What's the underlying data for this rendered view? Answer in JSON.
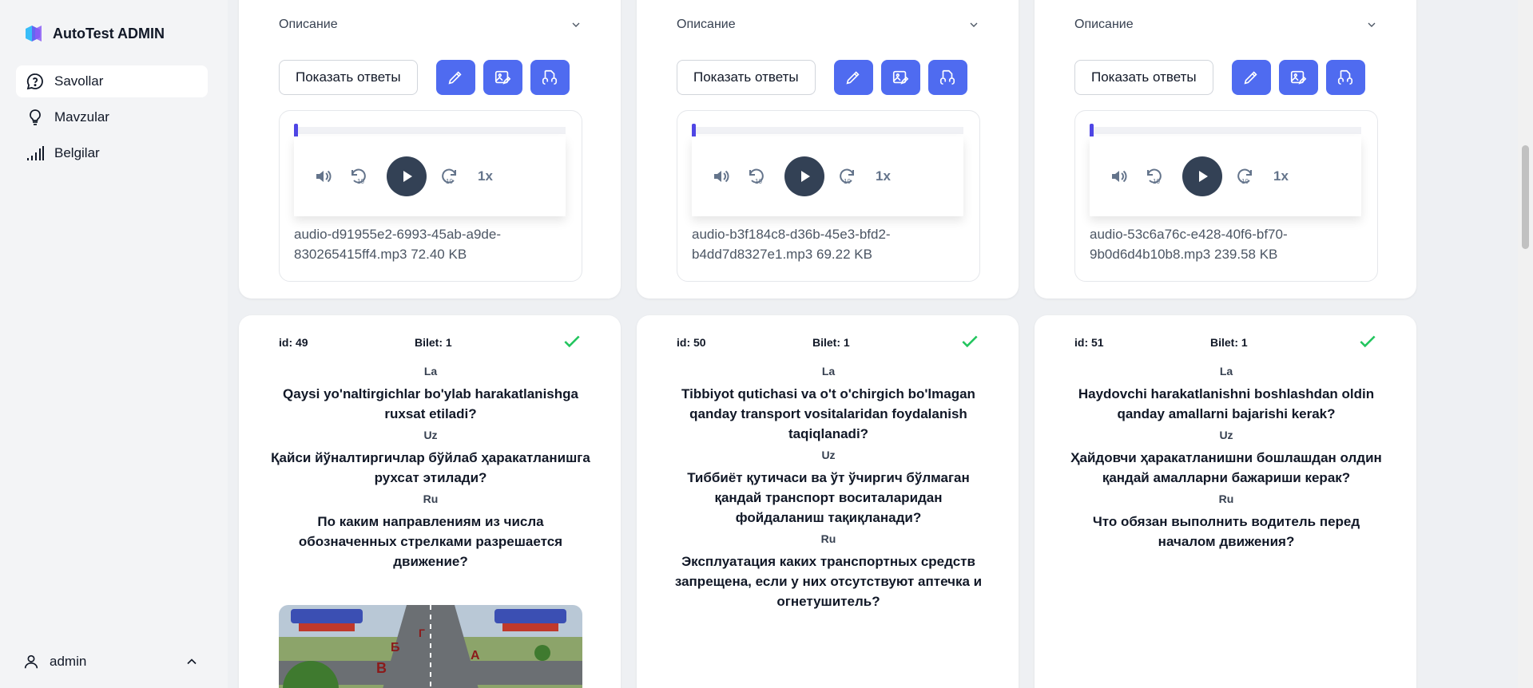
{
  "app": {
    "title": "AutoTest ADMIN"
  },
  "sidebar": {
    "items": [
      {
        "label": "Savollar",
        "icon": "chat-question-icon",
        "active": true
      },
      {
        "label": "Mavzular",
        "icon": "lightbulb-icon",
        "active": false
      },
      {
        "label": "Belgilar",
        "icon": "signal-bars-icon",
        "active": false
      }
    ],
    "user": {
      "name": "admin"
    }
  },
  "colors": {
    "accent": "#4f6bf0",
    "check": "#22c55e",
    "progress": "#4f46e5",
    "play": "#334155"
  },
  "top_cards": [
    {
      "description_label": "Описание",
      "show_answers_label": "Показать ответы",
      "speed": "1x",
      "file_name": "audio-d91955e2-6993-45ab-a9de-830265415ff4.mp3",
      "file_size": "72.40 KB"
    },
    {
      "description_label": "Описание",
      "show_answers_label": "Показать ответы",
      "speed": "1x",
      "file_name": "audio-b3f184c8-d36b-45e3-bfd2-b4dd7d8327e1.mp3",
      "file_size": "69.22 KB"
    },
    {
      "description_label": "Описание",
      "show_answers_label": "Показать ответы",
      "speed": "1x",
      "file_name": "audio-53c6a76c-e428-40f6-bf70-9b0d6d4b10b8.mp3",
      "file_size": "239.58 KB"
    }
  ],
  "question_cards": [
    {
      "id": "id: 49",
      "bilet": "Bilet: 1",
      "la_label": "La",
      "la": "Qaysi yo'naltirgichlar bo'ylab harakatlanishga ruxsat etiladi?",
      "uz_label": "Uz",
      "uz": "Қайси йўналтиргичлар бўйлаб ҳаракатланишга рухсат этилади?",
      "ru_label": "Ru",
      "ru": "По каким направлениям из числа обозначенных стрелками разрешается движение?",
      "image_labels": [
        "Б",
        "Г",
        "В",
        "А"
      ]
    },
    {
      "id": "id: 50",
      "bilet": "Bilet: 1",
      "la_label": "La",
      "la": "Tibbiyot qutichasi va o't o'chirgich bo'lmagan qanday transport vositalaridan foydalanish taqiqlanadi?",
      "uz_label": "Uz",
      "uz": "Тиббиёт қутичаси ва ўт ўчиргич бўлмаган қандай транспорт воситаларидан фойдаланиш тақиқланади?",
      "ru_label": "Ru",
      "ru": "Эксплуатация каких транспортных средств запрещена, если у них отсутствуют аптечка и огнетушитель?"
    },
    {
      "id": "id: 51",
      "bilet": "Bilet: 1",
      "la_label": "La",
      "la": "Haydovchi harakatlanishni boshlashdan oldin qanday amallarni bajarishi kerak?",
      "uz_label": "Uz",
      "uz": "Ҳайдовчи ҳаракатланишни бошлашдан олдин қандай амалларни бажариши керак?",
      "ru_label": "Ru",
      "ru": "Что обязан выполнить водитель перед началом движения?"
    }
  ]
}
